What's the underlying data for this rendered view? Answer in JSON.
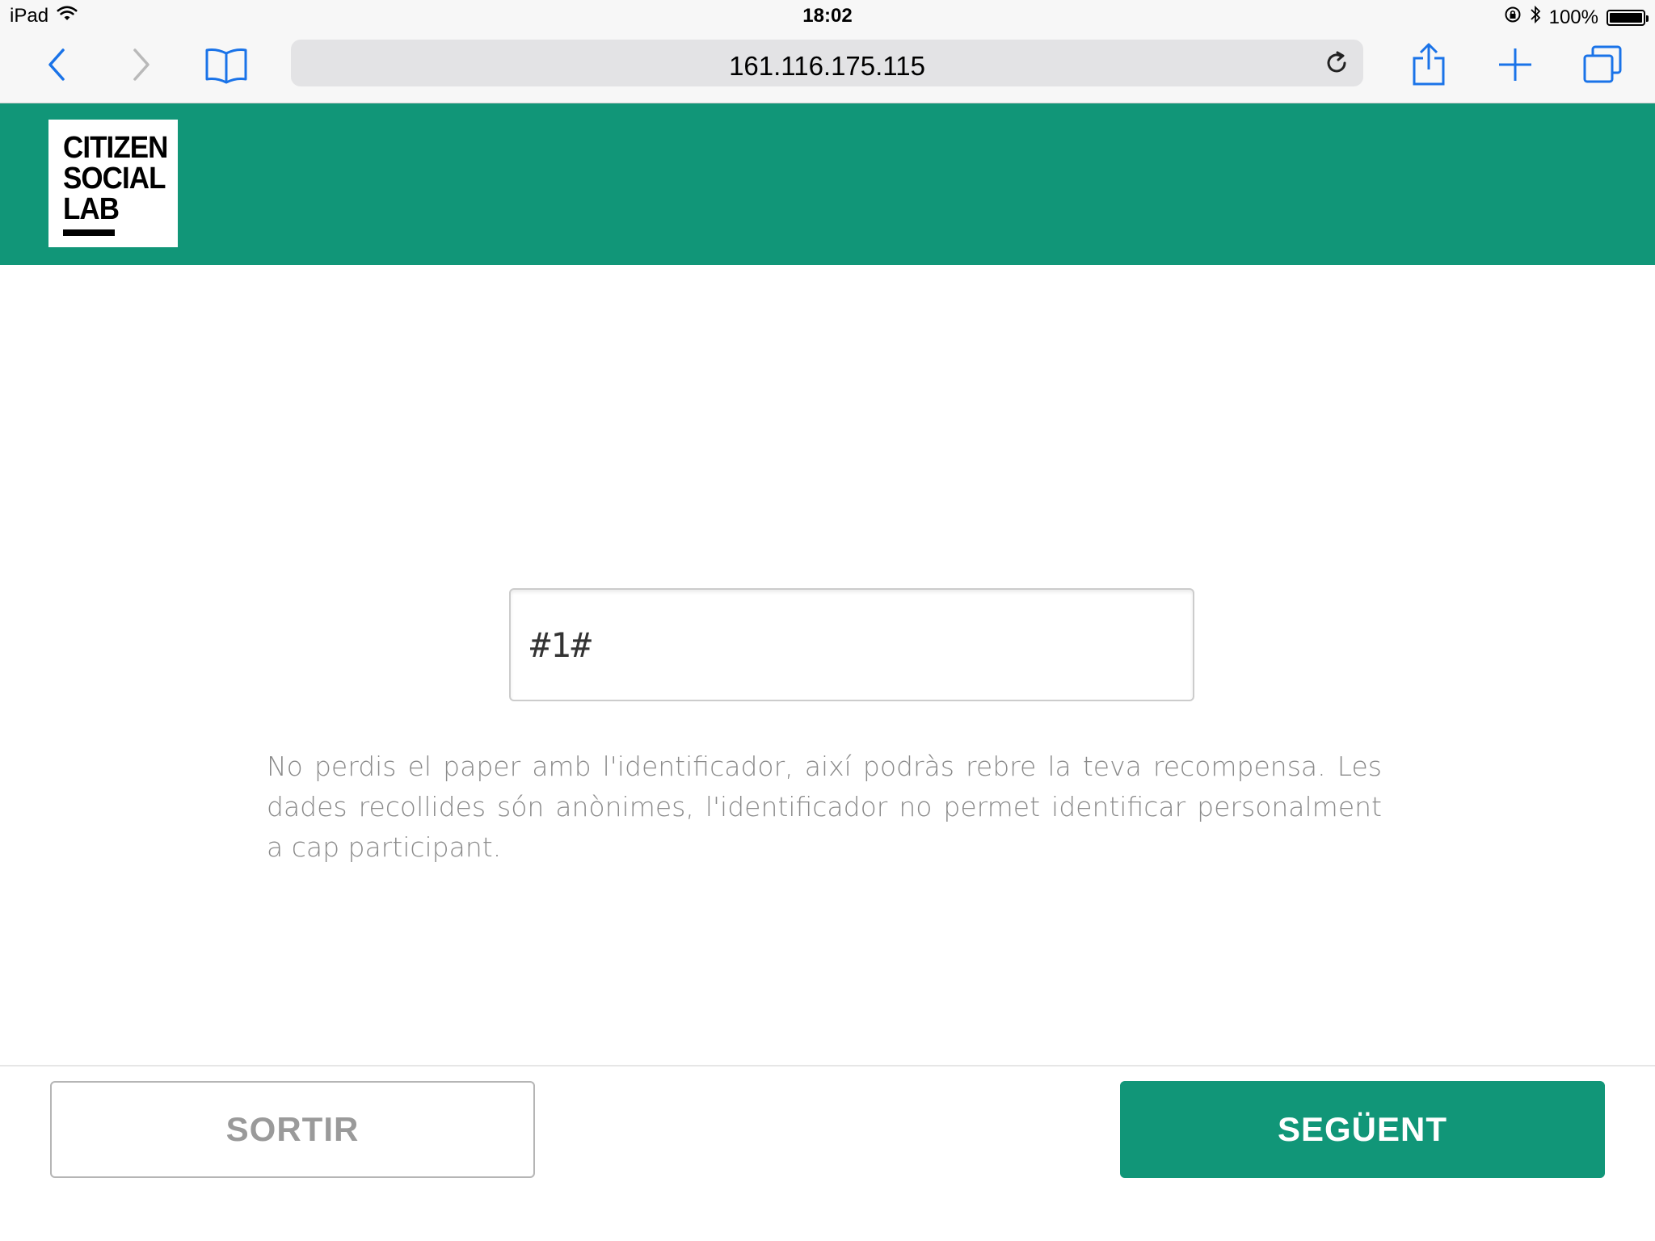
{
  "status_bar": {
    "device": "iPad",
    "time": "18:02",
    "battery": "100%"
  },
  "browser": {
    "url": "161.116.175.115",
    "icons": {
      "back": "chevron-left-icon",
      "forward": "chevron-right-icon",
      "bookmarks": "open-book-icon",
      "reload": "reload-icon",
      "share": "share-icon",
      "new_tab": "plus-icon",
      "tabs": "tabs-icon"
    }
  },
  "header": {
    "logo_lines": [
      "CITIZEN",
      "SOCIAL",
      "LAB"
    ],
    "background_color": "#119678"
  },
  "form": {
    "identifier_value": "#1#",
    "info_text": "No perdis el paper amb l'identificador, així podràs rebre la teva recompensa. Les dades recollides són anònimes, l'identificador no permet identificar personalment a cap participant."
  },
  "footer": {
    "exit_label": "SORTIR",
    "next_label": "SEGÜENT"
  },
  "colors": {
    "accent": "#119678",
    "ios_blue": "#1a73e8",
    "text_muted": "#8a8a8a"
  }
}
